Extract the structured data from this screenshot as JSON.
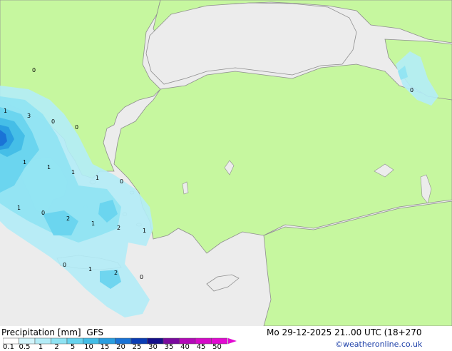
{
  "footer": {
    "title": "Precipitation [mm]",
    "model": "GFS",
    "datetime": "Mo 29-12-2025 21..00 UTC (18+270",
    "credit": "©weatheronline.co.uk"
  },
  "legend": {
    "ticks": [
      "0.1",
      "0.5",
      "1",
      "2",
      "5",
      "10",
      "15",
      "20",
      "25",
      "30",
      "35",
      "40",
      "45",
      "50"
    ],
    "colors": [
      "#ffffff",
      "#d2f4fb",
      "#b3ecf7",
      "#8fe3f3",
      "#67d3ee",
      "#43bde6",
      "#2a9ee0",
      "#1a73d6",
      "#0b3db4",
      "#15108a",
      "#7a0a9e",
      "#b30ab8",
      "#d50ac8",
      "#e20ad2"
    ]
  },
  "map_labels": [
    "1",
    "3",
    "0",
    "0",
    "1",
    "1",
    "1",
    "0",
    "0",
    "1",
    "1",
    "2",
    "1",
    "2",
    "1",
    "0",
    "1",
    "2",
    "0",
    "0",
    "0"
  ],
  "colors": {
    "land": "#c6f79f",
    "sea": "#ececec",
    "border": "#8e8e8e"
  }
}
